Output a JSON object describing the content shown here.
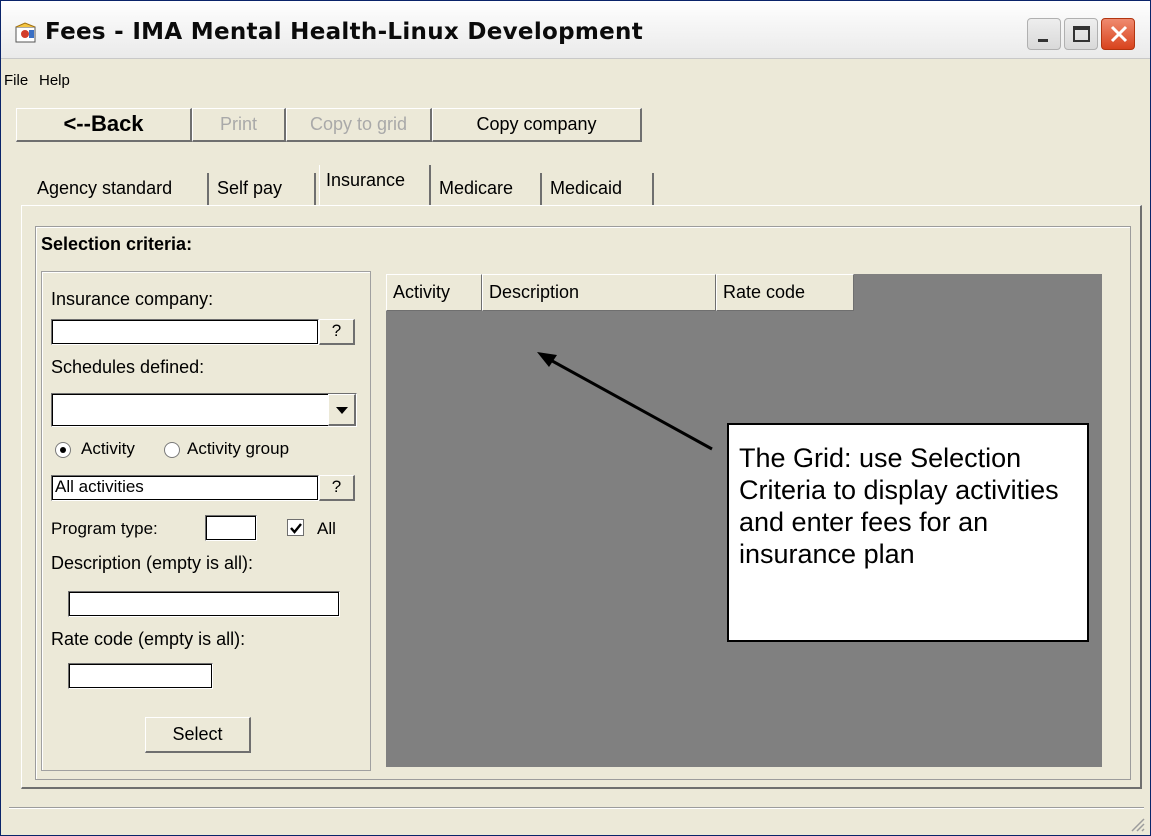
{
  "window": {
    "title": "Fees - IMA Mental Health-Linux Development",
    "controls": {
      "minimize_icon": "minimize-icon",
      "maximize_icon": "maximize-icon",
      "close_icon": "close-icon"
    }
  },
  "menu": {
    "file": "File",
    "help": "Help"
  },
  "toolbar": {
    "back": "<--Back",
    "print": "Print",
    "copy_to_grid": "Copy to grid",
    "copy_company": "Copy company"
  },
  "tabs": [
    {
      "label": "Agency standard",
      "active": false
    },
    {
      "label": "Self pay",
      "active": false
    },
    {
      "label": "Insurance",
      "active": true
    },
    {
      "label": "Medicare",
      "active": false
    },
    {
      "label": "Medicaid",
      "active": false
    }
  ],
  "criteria": {
    "title": "Selection criteria:",
    "insurance_company_label": "Insurance company:",
    "insurance_company_value": "",
    "lookup_button": "?",
    "schedules_label": "Schedules defined:",
    "schedules_value": "",
    "radio_activity": "Activity",
    "radio_activity_group": "Activity group",
    "radio_selected": "Activity",
    "activities_value": "All activities",
    "program_type_label": "Program type:",
    "program_type_value": "",
    "all_checkbox_label": "All",
    "all_checked": true,
    "description_label": "Description (empty is all):",
    "description_value": "",
    "rate_code_label": "Rate code (empty is all):",
    "rate_code_value": "",
    "select_button": "Select"
  },
  "grid": {
    "columns": [
      "Activity",
      "Description",
      "Rate code"
    ],
    "rows": []
  },
  "annotation": {
    "text": "The Grid: use Selection Criteria to display activities and enter fees for an insurance plan"
  },
  "colors": {
    "window_bg": "#ece9d8",
    "grid_bg": "#808080",
    "close_button": "#d8431d",
    "disabled_text": "#a9a9a9"
  }
}
